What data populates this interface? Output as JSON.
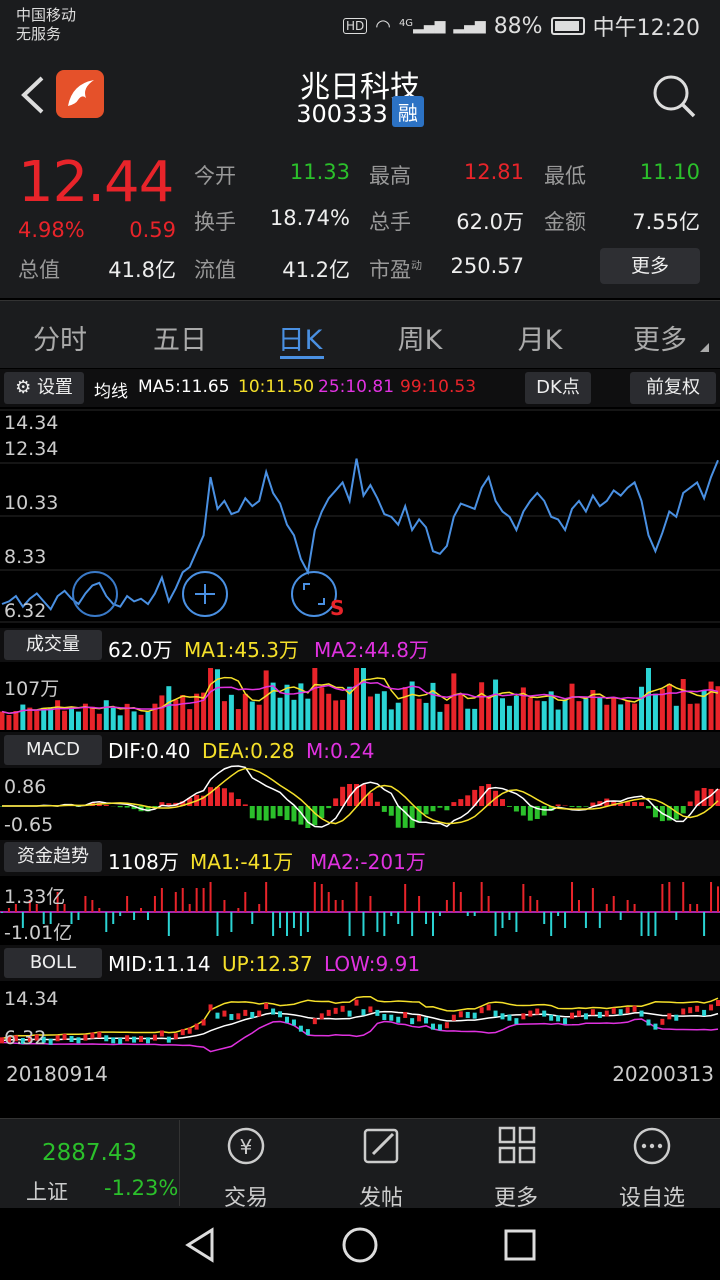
{
  "status_bar": {
    "carrier_line1": "中国移动",
    "carrier_line2": "无服务",
    "hd": "HD",
    "net": "4G",
    "battery": "88%",
    "time": "中午12:20"
  },
  "header": {
    "stock_name": "兆日科技",
    "stock_code": "300333",
    "badge": "融"
  },
  "quote": {
    "price": "12.44",
    "change_pct": "4.98%",
    "change": "0.59",
    "open_label": "今开",
    "open": "11.33",
    "high_label": "最高",
    "high": "12.81",
    "low_label": "最低",
    "low": "11.10",
    "turnover_label": "换手",
    "turnover": "18.74%",
    "volume_label": "总手",
    "volume": "62.0万",
    "amount_label": "金额",
    "amount": "7.55亿",
    "mktcap_label": "总值",
    "mktcap": "41.8亿",
    "float_label": "流值",
    "float": "41.2亿",
    "pe_label": "市盈",
    "pe_sup": "动",
    "pe": "250.57",
    "more": "更多"
  },
  "tabs": [
    "分时",
    "五日",
    "日K",
    "周K",
    "月K",
    "更多"
  ],
  "settings_bar": {
    "settings": "设置",
    "ma_label": "均线",
    "ma5": "MA5:11.65",
    "ma10": "10:11.50",
    "ma25": "25:10.81",
    "ma99": "99:10.53",
    "dk": "DK点",
    "fq": "前复权"
  },
  "main_axis": [
    "14.34",
    "12.34",
    "10.33",
    "8.33",
    "6.32"
  ],
  "volume": {
    "label": "成交量",
    "value": "62.0万",
    "ma1": "MA1:45.3万",
    "ma2": "MA2:44.8万",
    "axis": "107万"
  },
  "macd": {
    "label": "MACD",
    "dif": "DIF:0.40",
    "dea": "DEA:0.28",
    "m": "M:0.24",
    "axis_top": "0.86",
    "axis_bottom": "-0.65"
  },
  "fund": {
    "label": "资金趋势",
    "value": "1108万",
    "ma1": "MA1:-41万",
    "ma2": "MA2:-201万",
    "axis_top": "1.33亿",
    "axis_bottom": "-1.01亿"
  },
  "boll": {
    "label": "BOLL",
    "mid": "MID:11.14",
    "up": "UP:12.37",
    "low": "LOW:9.91",
    "axis_top": "14.34",
    "axis_bottom": "6.32"
  },
  "dates": {
    "start": "20180914",
    "end": "20200313"
  },
  "index": {
    "value": "2887.43",
    "name": "上证",
    "change": "-1.23%"
  },
  "bottom_nav": [
    "交易",
    "发帖",
    "更多",
    "设自选"
  ],
  "colors": {
    "up": "#e8242a",
    "down": "#2bc02b",
    "line": "#4a90e2",
    "ma1": "#f5e02a",
    "ma2": "#e032e0"
  },
  "chart_data": {
    "type": "line",
    "title": "",
    "ylim": [
      6.32,
      14.34
    ],
    "series": [
      {
        "values": [
          7.0,
          7.1,
          7.3,
          6.9,
          7.2,
          7.4,
          7.1,
          6.8,
          7.3,
          7.5,
          7.2,
          7.0,
          7.4,
          7.7,
          7.8,
          7.3,
          7.0,
          6.9,
          7.3,
          7.1,
          7.2,
          7.0,
          7.4,
          8.0,
          7.1,
          7.6,
          8.2,
          8.4,
          9.0,
          9.6,
          11.8,
          10.6,
          10.9,
          10.4,
          10.5,
          11.0,
          10.7,
          10.9,
          12.0,
          11.2,
          10.8,
          10.0,
          9.6,
          8.7,
          8.2,
          9.8,
          10.5,
          11.0,
          11.3,
          11.6,
          10.9,
          12.5,
          11.1,
          11.5,
          11.0,
          10.4,
          10.3,
          10.0,
          10.7,
          9.8,
          10.2,
          9.9,
          9.0,
          8.9,
          9.2,
          10.3,
          10.8,
          10.7,
          10.6,
          11.4,
          11.8,
          10.9,
          10.5,
          10.3,
          9.8,
          10.5,
          10.9,
          11.2,
          10.9,
          10.3,
          10.2,
          9.8,
          10.6,
          10.9,
          10.5,
          11.1,
          10.7,
          10.9,
          11.3,
          11.1,
          11.4,
          11.6,
          10.9,
          9.6,
          9.0,
          9.7,
          10.5,
          10.3,
          11.2,
          11.4,
          11.6,
          11.0,
          11.8,
          12.44
        ]
      }
    ]
  }
}
